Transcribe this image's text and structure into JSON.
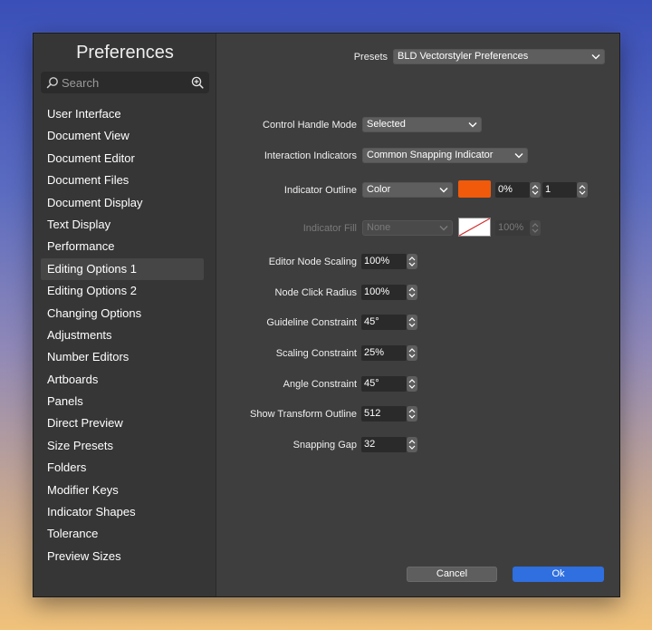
{
  "sidebar": {
    "title": "Preferences",
    "search_placeholder": "Search",
    "items": [
      {
        "label": "User Interface"
      },
      {
        "label": "Document View"
      },
      {
        "label": "Document Editor"
      },
      {
        "label": "Document Files"
      },
      {
        "label": "Document Display"
      },
      {
        "label": "Text Display"
      },
      {
        "label": "Performance"
      },
      {
        "label": "Editing Options 1"
      },
      {
        "label": "Editing Options 2"
      },
      {
        "label": "Changing Options"
      },
      {
        "label": "Adjustments"
      },
      {
        "label": "Number Editors"
      },
      {
        "label": "Artboards"
      },
      {
        "label": "Panels"
      },
      {
        "label": "Direct Preview"
      },
      {
        "label": "Size Presets"
      },
      {
        "label": "Folders"
      },
      {
        "label": "Modifier Keys"
      },
      {
        "label": "Indicator Shapes"
      },
      {
        "label": "Tolerance"
      },
      {
        "label": "Preview Sizes"
      }
    ],
    "active_item": "Editing Options 1"
  },
  "presets": {
    "label": "Presets",
    "value": "BLD Vectorstyler Preferences"
  },
  "control_handle_mode": {
    "label": "Control Handle Mode",
    "value": "Selected"
  },
  "interaction_indicators": {
    "label": "Interaction Indicators",
    "value": "Common Snapping Indicator"
  },
  "indicator_outline": {
    "label": "Indicator Outline",
    "mode": "Color",
    "color": "#f05a0a",
    "opacity": "0%",
    "width": "1"
  },
  "indicator_fill": {
    "label": "Indicator Fill",
    "mode": "None",
    "opacity": "100%"
  },
  "editor_node_scaling": {
    "label": "Editor Node Scaling",
    "value": "100%"
  },
  "node_click_radius": {
    "label": "Node Click Radius",
    "value": "100%"
  },
  "guideline_constraint": {
    "label": "Guideline Constraint",
    "value": "45°"
  },
  "scaling_constraint": {
    "label": "Scaling Constraint",
    "value": "25%"
  },
  "angle_constraint": {
    "label": "Angle Constraint",
    "value": "45°"
  },
  "show_transform_outline": {
    "label": "Show Transform Outline",
    "value": "512"
  },
  "snapping_gap": {
    "label": "Snapping Gap",
    "value": "32"
  },
  "buttons": {
    "cancel": "Cancel",
    "ok": "Ok"
  },
  "colors": {
    "ok_button": "#2f6fe0",
    "cancel_button": "#5e5e5e",
    "window_bg": "#3e3e3e",
    "sidebar_bg": "#363636"
  }
}
